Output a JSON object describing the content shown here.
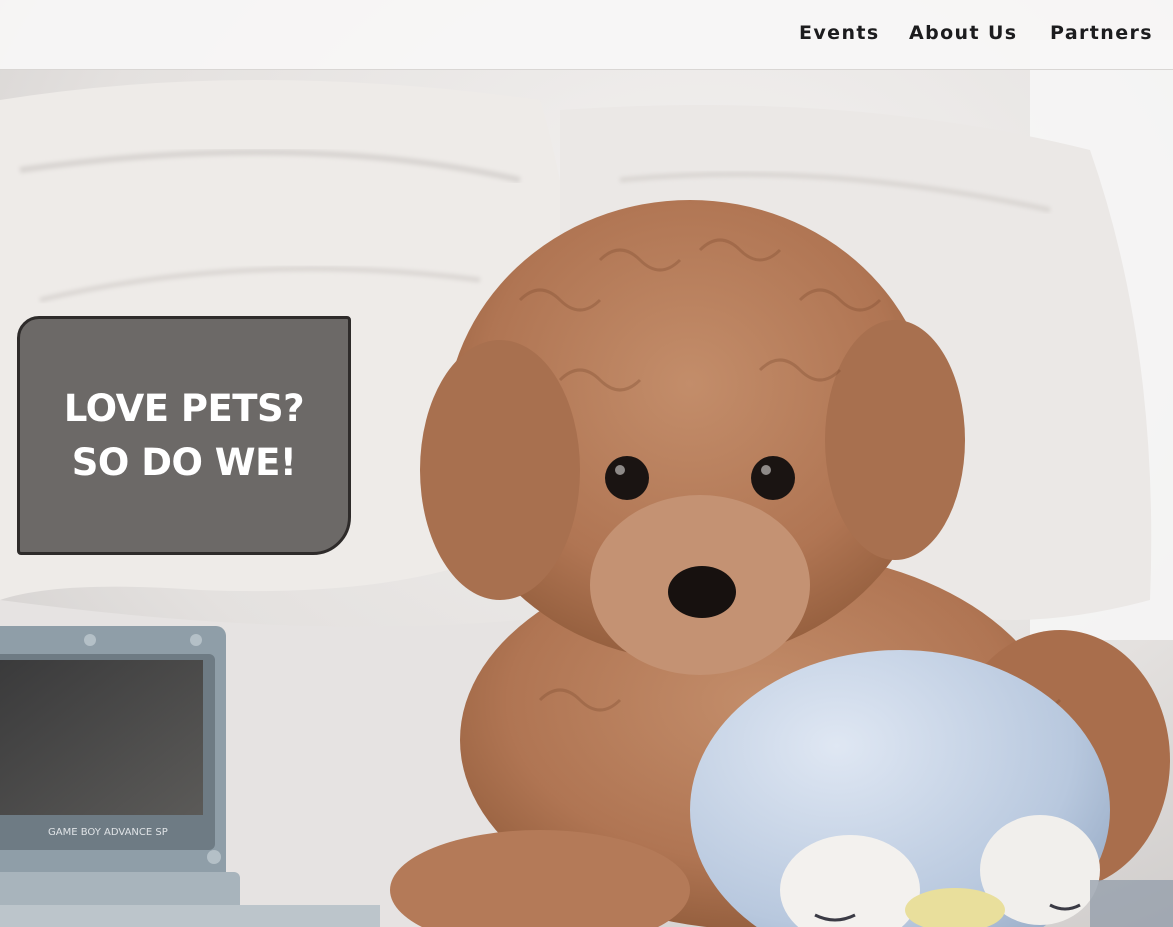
{
  "nav": {
    "items": [
      {
        "label": "Events"
      },
      {
        "label": "About Us"
      },
      {
        "label": "Partners"
      }
    ]
  },
  "hero": {
    "headline_line1": "LOVE PETS?",
    "headline_line2": "SO DO WE!",
    "device_label": "GAME BOY ADVANCE SP",
    "image_subject": "toy-poodle-puppy-with-plush-penguin-on-bed"
  },
  "colors": {
    "nav_text": "#1c1c1e",
    "callout_bg": "#484442",
    "callout_border": "#2e2b2a",
    "headline": "#ffffff",
    "puppy_fur": "#b97f5b",
    "plush": "#c6d3e6"
  },
  "icons": {
    "photo": "hero-photo"
  }
}
